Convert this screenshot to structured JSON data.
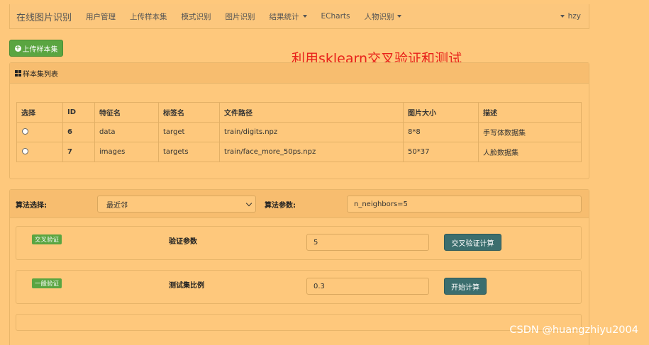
{
  "navbar": {
    "brand": "在线图片识别",
    "items": [
      {
        "label": "用户管理",
        "dropdown": false
      },
      {
        "label": "上传样本集",
        "dropdown": false
      },
      {
        "label": "模式识别",
        "dropdown": false
      },
      {
        "label": "图片识别",
        "dropdown": false
      },
      {
        "label": "结果统计",
        "dropdown": true
      },
      {
        "label": "ECharts",
        "dropdown": false
      },
      {
        "label": "人物识别",
        "dropdown": true
      }
    ],
    "user": "hzy"
  },
  "upload_button": {
    "label": "上传样本集"
  },
  "overlay_title": "利用sklearn交叉验证和测试",
  "sample_panel": {
    "title": "样本集列表",
    "columns": [
      "选择",
      "ID",
      "特征名",
      "标签名",
      "文件路径",
      "图片大小",
      "描述"
    ],
    "rows": [
      {
        "id": "6",
        "feature": "data",
        "label": "target",
        "path": "train/digits.npz",
        "size": "8*8",
        "desc": "手写体数据集"
      },
      {
        "id": "7",
        "feature": "images",
        "label": "targets",
        "path": "train/face_more_50ps.npz",
        "size": "50*37",
        "desc": "人脸数据集"
      }
    ]
  },
  "algorithm": {
    "select_label": "算法选择:",
    "selected": "最近邻",
    "param_label": "算法参数:",
    "param_value": "n_neighbors=5"
  },
  "cross_validation": {
    "badge": "交叉验证",
    "param_label": "验证参数",
    "value": "5",
    "button": "交叉验证计算"
  },
  "test_validation": {
    "badge": "一般验证",
    "param_label": "测试集比例",
    "value": "0.3",
    "button": "开始计算"
  },
  "watermark": "CSDN @huangzhiyu2004",
  "colors": {
    "background": "#fec87c",
    "success": "#5aa541",
    "primary_dark": "#3b6e6e",
    "title_red": "#e8211a"
  }
}
